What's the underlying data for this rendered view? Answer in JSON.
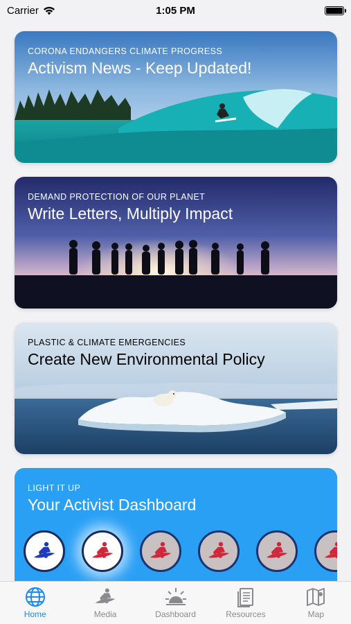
{
  "status_bar": {
    "carrier": "Carrier",
    "time": "1:05 PM"
  },
  "cards": [
    {
      "kicker": "CORONA ENDANGERS CLIMATE PROGRESS",
      "title": "Activism News - Keep Updated!"
    },
    {
      "kicker": "DEMAND PROTECTION OF OUR PLANET",
      "title": "Write Letters, Multiply Impact"
    },
    {
      "kicker": "PLASTIC & CLIMATE EMERGENCIES",
      "title": "Create New Environmental Policy"
    }
  ],
  "dashboard": {
    "kicker": "LIGHT IT UP",
    "title": "Your Activist Dashboard",
    "badges": [
      {
        "icon": "surfer-icon",
        "color": "#1f3cb8",
        "state": "active"
      },
      {
        "icon": "surfer-icon",
        "color": "#d0283a",
        "state": "active"
      },
      {
        "icon": "surfer-icon",
        "color": "#d0283a",
        "state": "inactive"
      },
      {
        "icon": "surfer-icon",
        "color": "#d0283a",
        "state": "inactive"
      },
      {
        "icon": "surfer-icon",
        "color": "#d0283a",
        "state": "inactive"
      },
      {
        "icon": "surfer-icon",
        "color": "#d0283a",
        "state": "inactive"
      }
    ]
  },
  "tabs": [
    {
      "label": "Home",
      "icon": "globe-icon",
      "selected": true
    },
    {
      "label": "Media",
      "icon": "surfer-icon",
      "selected": false
    },
    {
      "label": "Dashboard",
      "icon": "sun-icon",
      "selected": false
    },
    {
      "label": "Resources",
      "icon": "document-icon",
      "selected": false
    },
    {
      "label": "Map",
      "icon": "map-icon",
      "selected": false
    }
  ],
  "colors": {
    "accent": "#1a8cf0",
    "dashboard_bg": "#2aa0f5",
    "tab_inactive": "#8a8a8e"
  }
}
